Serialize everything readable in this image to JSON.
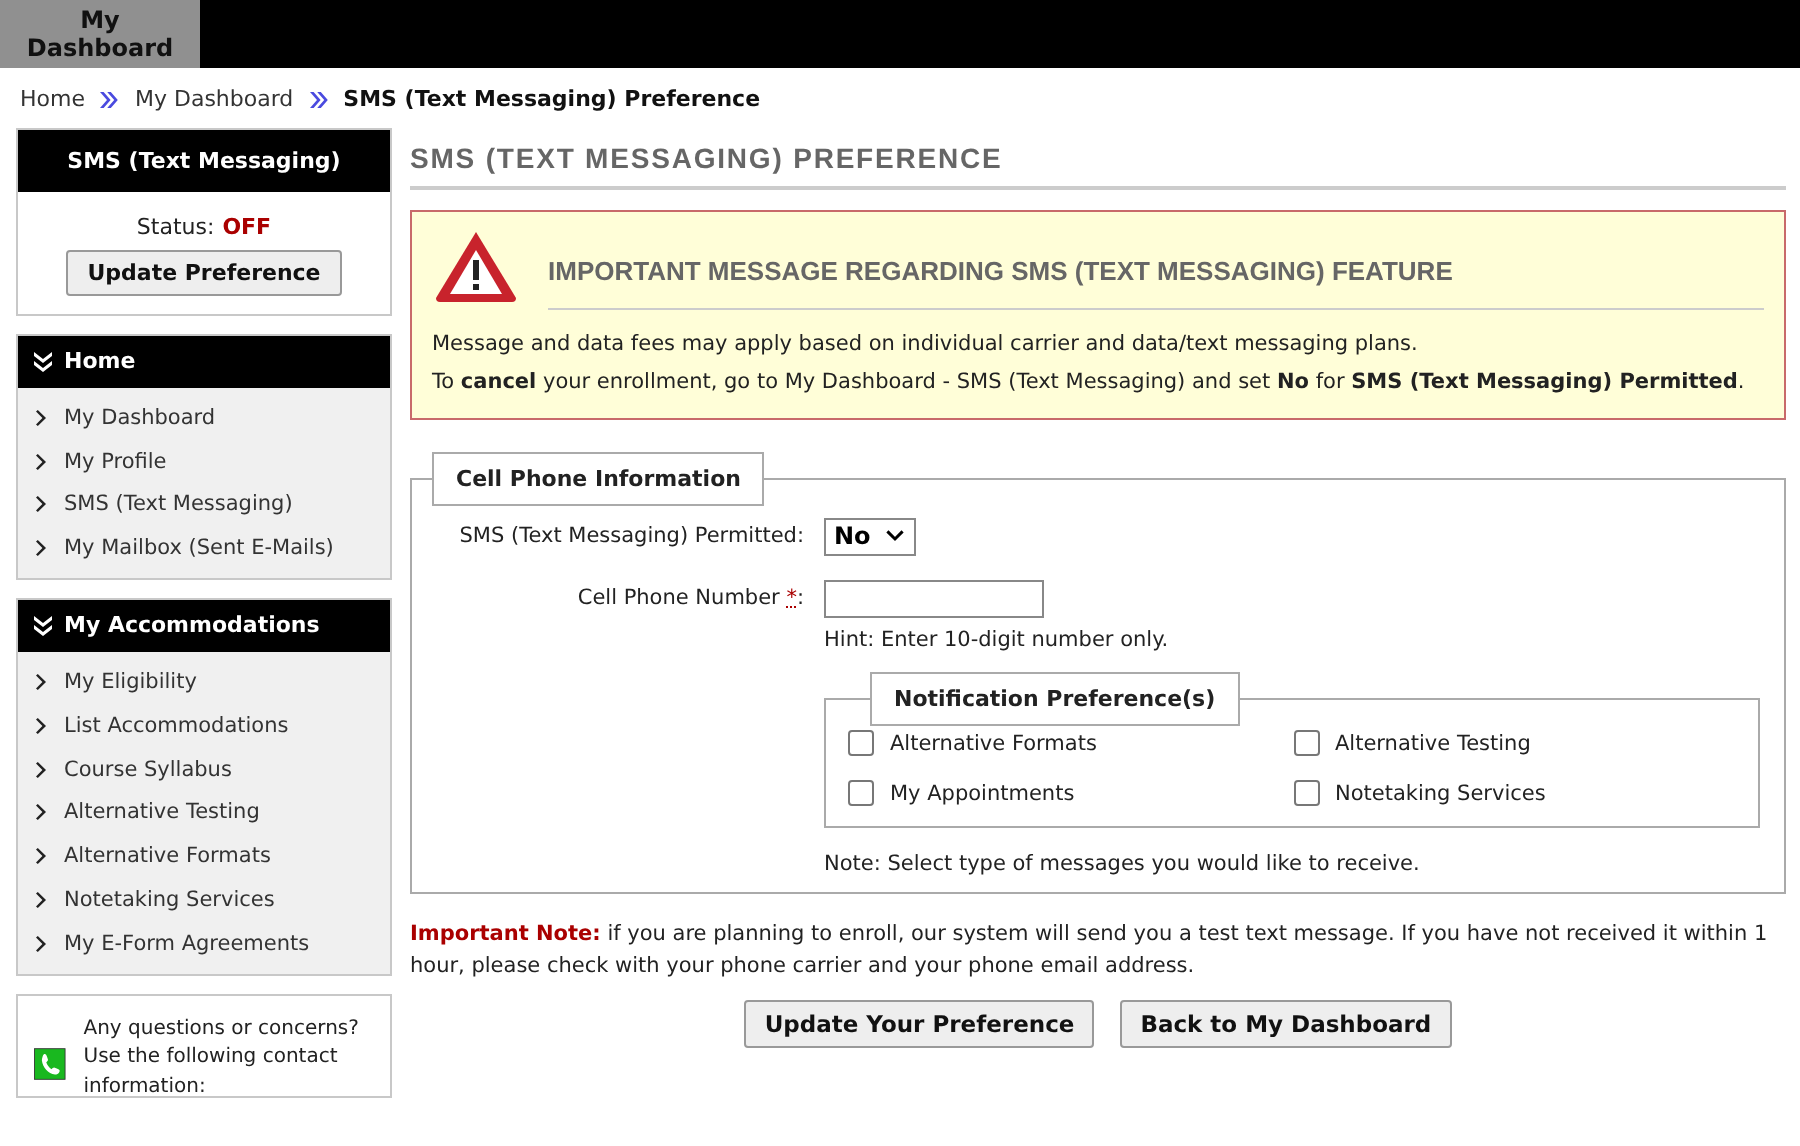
{
  "top_tabs": [
    {
      "label": "My Dashboard",
      "selected": true
    }
  ],
  "breadcrumb": [
    {
      "label": "Home",
      "current": false
    },
    {
      "label": "My Dashboard",
      "current": false
    },
    {
      "label": "SMS (Text Messaging) Preference",
      "current": true
    }
  ],
  "sidebar": {
    "status_box": {
      "title": "SMS (Text Messaging)",
      "status_label": "Status:",
      "status_value": "OFF",
      "button": "Update Preference"
    },
    "sections": [
      {
        "title": "Home",
        "items": [
          "My Dashboard",
          "My Profile",
          "SMS (Text Messaging)",
          "My Mailbox (Sent E-Mails)"
        ]
      },
      {
        "title": "My Accommodations",
        "items": [
          "My Eligibility",
          "List Accommodations",
          "Course Syllabus",
          "Alternative Testing",
          "Alternative Formats",
          "Notetaking Services",
          "My E-Form Agreements"
        ]
      }
    ],
    "contact": {
      "text": "Any questions or concerns? Use the following contact information:"
    }
  },
  "page_title": "SMS (TEXT MESSAGING) PREFERENCE",
  "alert": {
    "title": "IMPORTANT MESSAGE REGARDING SMS (TEXT MESSAGING) FEATURE",
    "lines": [
      "Message and data fees may apply based on individual carrier and data/text messaging plans.",
      "To **cancel** your enrollment, go to My Dashboard - SMS (Text Messaging) and set **No** for **SMS (Text Messaging) Permitted**."
    ]
  },
  "cell_phone": {
    "legend": "Cell Phone Information",
    "permitted": {
      "label": "SMS (Text Messaging) Permitted:",
      "value": "No"
    },
    "phone": {
      "label_before": "Cell Phone Number ",
      "required_mark": "*",
      "label_after": ":",
      "hint": "Hint: Enter 10-digit number only."
    },
    "notifications": {
      "legend": "Notification Preference(s)",
      "options": [
        {
          "label": "Alternative Formats",
          "checked": false
        },
        {
          "label": "Alternative Testing",
          "checked": false
        },
        {
          "label": "My Appointments",
          "checked": false
        },
        {
          "label": "Notetaking Services",
          "checked": false
        }
      ]
    },
    "note": "Note: Select type of messages you would like to receive."
  },
  "important_note": {
    "label": "Important Note:",
    "text": " if you are planning to enroll, our system will send you a test text message. If you have not received it within 1 hour, please check with your phone carrier and your phone email address."
  },
  "buttons": [
    "Update Your Preference",
    "Back to My Dashboard"
  ]
}
